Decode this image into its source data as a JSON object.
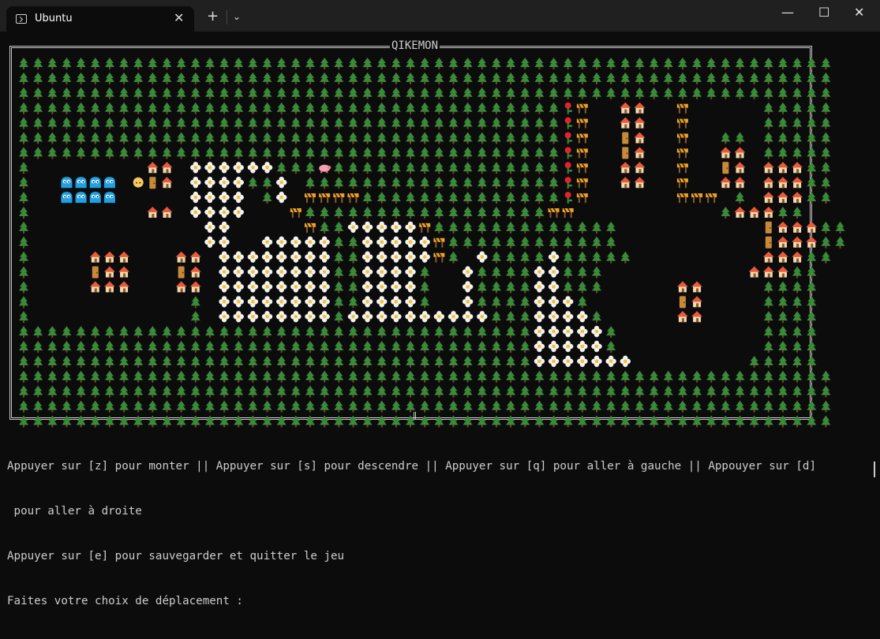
{
  "window": {
    "tab_title": "Ubuntu",
    "tab_close": "✕",
    "new_tab": "+",
    "dropdown": "⌄",
    "minimize": "—",
    "maximize": "☐",
    "close": "✕"
  },
  "game": {
    "title": "QIKEMON",
    "tile_glyphs": {
      "T": "tree",
      "F": "flower",
      "H": "house",
      "D": "door",
      "B": "barrier",
      "R": "rose",
      "P": "pig",
      "W": "water-creature",
      "Y": "player"
    },
    "map_rows": [
      "TTTTTTTTTTTTTTTTTTTTTTTTTTTTTTTTTTTTTTTTTTTTTTTTTTTTTTTTT",
      "TTTTTTTTTTTTTTTTTTTTTTTTTTTTTTTTTTTTTTTTTTTTTTTTTTTTTTTTT",
      "TTTTTTTTTTTTTTTTTTTTTTTTTTTTTTTTTTTTTTTTTTTTTTTTTTTTTTTTT",
      "TTTTTTTTTTTTTTTTTTTTTTTTTTTTTTTTTTTTTTRB..HH..B.....TTTTT",
      "TTTTTTTTTTTTTTTTTTTTTTTTTTTTTTTTTTTTTTRB..HH..B.....TTTTT",
      "TTTTTTTTTTTTTTTTTTTTTTTTTTTTTTTTTTTTTTRB..DH..B..TT.TTTTT",
      "TTTTTTTTTTTTTTTTTTTTTTTTTTTTTTTTTTTTTTRB..DH..B..HH.TTTTT",
      "T........HH.FFFFFFTTTPTTTTTTTTTTTTTTTTRB..HH..B..DH.HHHTT",
      "T..WWWW.YDH.FFFFTTF.TTTTTTTTTTTTTTTTTTRB..HH..B..HH.HHHTT",
      "T..WWWW.....FFFF.TF.BBBBTTTTTTTTTTTTTTRB......BBB.T.HHHTT",
      "T........HH.FFFF...BTTTTTTTTTTTTTTTTTBB..........THHHTT",
      "T............FF.....BTTFFFFFBTTTTTTTTTTTTT..........DHHHTT",
      "T............FF..FFFFFTTFFFFFBTTTTTTTTTTTT..........DHHHTT",
      "T....HHH...HH.FFFFFFFFTTFFFFFBT.FTTTTFTTTTT.........HHHTT",
      "T....DHH...DH.FFFFFFFFTTFFFFT..FTTTTFFTTT..........HHHTT",
      "T....HHH...HH.FFFFFFFFTTFFFFT..FTTTTFFTTT.....HH....TTTT",
      "T...........T.FFFFFFFFTTFFFFT..FTTTTFFFT......DH....TTTT",
      "T...........T.FFFFFFFFTFFFFFFFFFFTTTFFFFT.....HH....TTTT",
      "TTTTTTTTTTTTTTTTTTTTTTTTTTTTTTTTTTTTFFFFFT..........TTTT",
      "TTTTTTTTTTTTTTTTTTTTTTTTTTTTTTTTTTTTFFFFFT..........TTTT",
      "TTTTTTTTTTTTTTTTTTTTTTTTTTTTTTTTTTTTFFFFFFF........TTTTT",
      "TTTTTTTTTTTTTTTTTTTTTTTTTTTTTTTTTTTTTTTTTTTTTTTTTTTTTTTTT",
      "TTTTTTTTTTTTTTTTTTTTTTTTTTTTTTTTTTTTTTTTTTTTTTTTTTTTTTTTT",
      "TTTTTTTTTTTTTTTTTTTTTTTTTTTTTTTTTTTTTTTTTTTTTTTTTTTTTTTTT",
      "TTTTTTTTTTTTTTTTTTTTTTTTTTTTTTTTTTTTTTTTTTTTTTTTTTTTTTTTT"
    ]
  },
  "console": {
    "line1": "Appuyer sur [z] pour monter || Appuyer sur [s] pour descendre || Appuyer sur [q] pour aller à gauche || Appouyer sur [d]",
    "line2": " pour aller à droite",
    "line3": "Appuyer sur [e] pour sauvegarder et quitter le jeu",
    "line4": "Faites votre choix de déplacement :"
  },
  "colors": {
    "background": "#0c0c0c",
    "titlebar": "#202020",
    "text": "#cccccc",
    "tree": "#3a8a3a",
    "water": "#1aa3e8"
  }
}
